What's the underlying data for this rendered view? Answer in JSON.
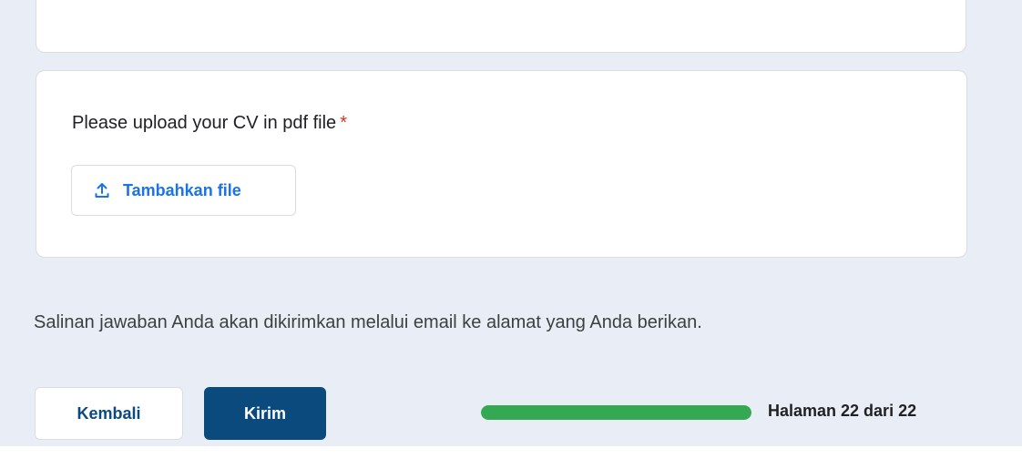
{
  "question": {
    "title": "Please upload your CV in pdf file",
    "required_marker": "*",
    "upload_button_label": "Tambahkan file",
    "upload_icon": "upload-icon"
  },
  "footer": {
    "copy_note": "Salinan jawaban Anda akan dikirimkan melalui email ke alamat yang Anda berikan.",
    "back_label": "Kembali",
    "submit_label": "Kirim",
    "progress_fraction": 1.0,
    "page_indicator": "Halaman 22 dari 22"
  },
  "colors": {
    "page_background": "#e9eef6",
    "accent_blue": "#1a73e8",
    "submit_button": "#0a4a7c",
    "required_red": "#d93025",
    "progress_green": "#34a853"
  }
}
